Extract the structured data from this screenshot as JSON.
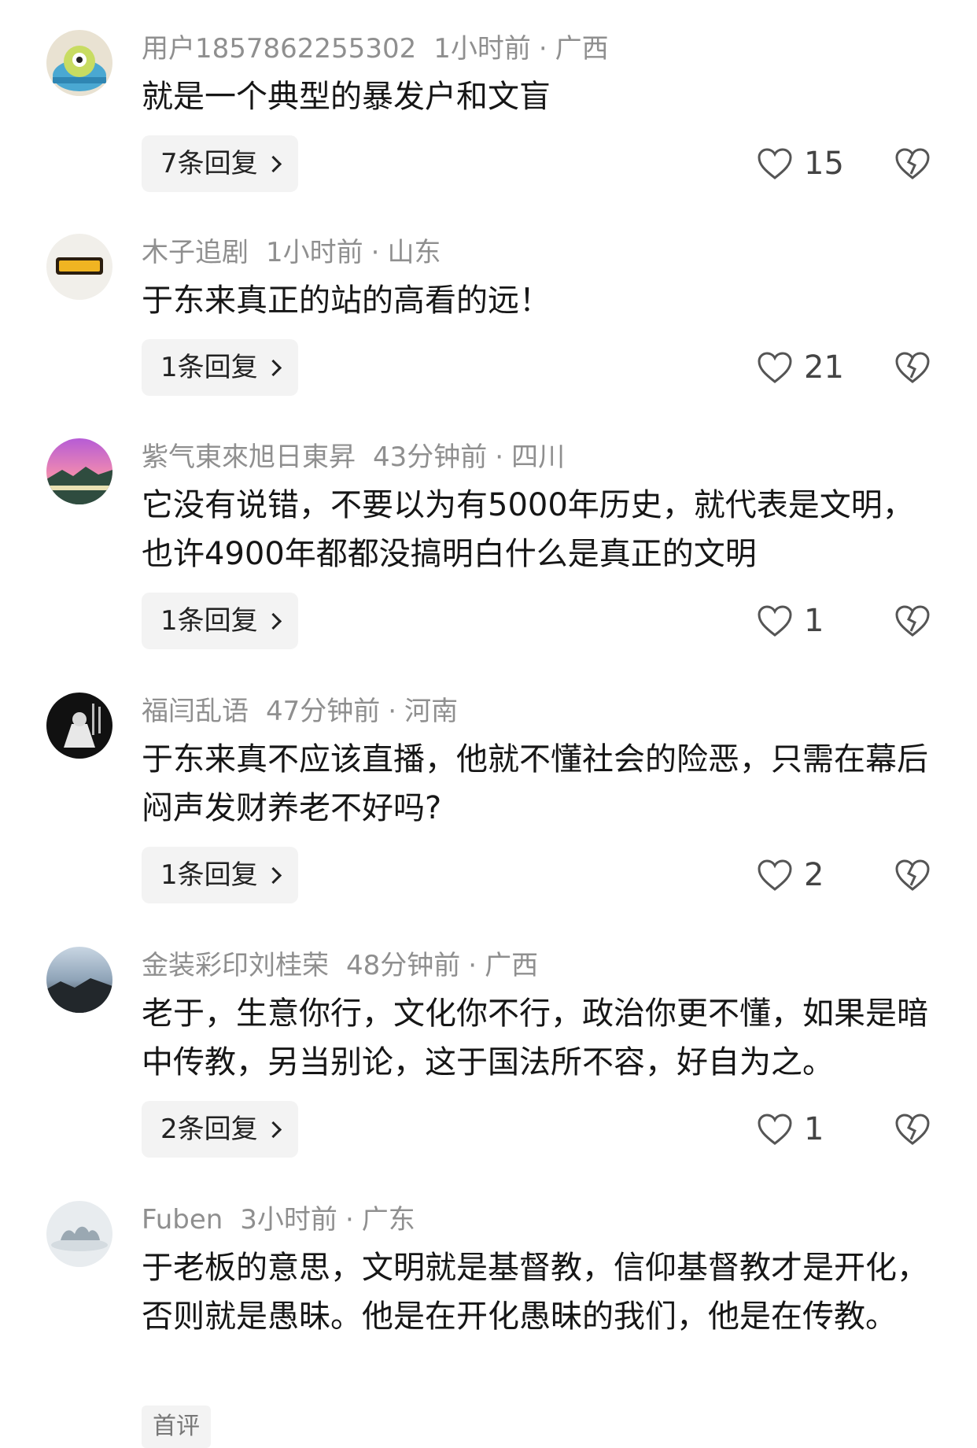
{
  "comments": [
    {
      "username": "用户1857862255302",
      "time": "1小时前",
      "location": "广西",
      "text": "就是一个典型的暴发户和文盲",
      "replies_label": "7条回复",
      "likes": "15"
    },
    {
      "username": "木子追剧",
      "time": "1小时前",
      "location": "山东",
      "text": "于东来真正的站的高看的远！",
      "replies_label": "1条回复",
      "likes": "21"
    },
    {
      "username": "紫气東來旭日東昇",
      "time": "43分钟前",
      "location": "四川",
      "text": "它没有说错，不要以为有5000年历史，就代表是文明，也许4900年都都没搞明白什么是真正的文明",
      "replies_label": "1条回复",
      "likes": "1"
    },
    {
      "username": "福闫乱语",
      "time": "47分钟前",
      "location": "河南",
      "text": "于东来真不应该直播，他就不懂社会的险恶，只需在幕后闷声发财养老不好吗?",
      "replies_label": "1条回复",
      "likes": "2"
    },
    {
      "username": "金装彩印刘桂荣",
      "time": "48分钟前",
      "location": "广西",
      "text": "老于，生意你行，文化你不行，政治你更不懂，如果是暗中传教，另当别论，这于国法所不容，好自为之。",
      "replies_label": "2条回复",
      "likes": "1"
    },
    {
      "username": "Fuben",
      "time": "3小时前",
      "location": "广东",
      "text": "于老板的意思，文明就是基督教，信仰基督教才是开化，否则就是愚昧。他是在开化愚昧的我们，他是在传教。",
      "tag": "首评"
    }
  ],
  "separator": "·",
  "icons": {
    "like": "heart-outline-icon",
    "dislike": "broken-heart-icon",
    "reply": "chevron-right-icon"
  },
  "colors": {
    "meta_text": "#8f8f8f",
    "body_text": "#161616",
    "button_bg": "#f3f3f3"
  }
}
